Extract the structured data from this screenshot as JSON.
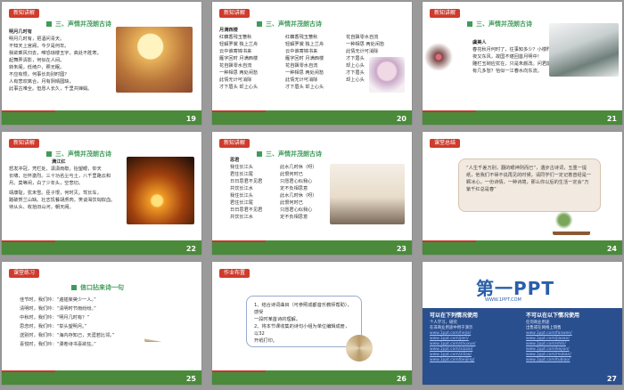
{
  "slides": [
    {
      "id": "s19",
      "number": "19",
      "tag": "新知讲解",
      "title": "三、声情并茂朗古诗",
      "heading": "明月几时有",
      "lines": [
        "明月几时有，把酒问青天。",
        "不知天上宫阙，今夕是何年。",
        "我欲乘风归去，唯恐琼楼玉宇，高处不胜寒。",
        "起舞弄清影，何似在人间。",
        "转朱阁，低绮户，照无眠。",
        "不应有恨，何事长向别时圆？",
        "人有悲欢离合，月有阴晴圆缺，",
        "此事古难全。但愿人长久，千里共婵娟。"
      ]
    },
    {
      "id": "s20",
      "number": "20",
      "tag": "新知讲解",
      "title": "三、声情并茂朗古诗",
      "heading": "月满西楼",
      "col1": [
        "红藕香残玉簟秋",
        "轻解罗裳 独上兰舟",
        "云中谁寄锦书来",
        "雁字回时 月满西楼",
        "花自飘零水自流",
        "一种相思 两处闲愁",
        "此情无计可消除",
        "才下眉头 却上心头"
      ],
      "col2": [
        "红藕香残玉簟秋",
        "轻解罗裳 独上兰舟",
        "云中谁寄锦书来",
        "雁字回时 月满西楼",
        "花自飘零水自流",
        "一种相思 两处闲愁",
        "此情无计可消除",
        "才下眉头 却上心头"
      ],
      "col3": [
        "花自飘零水自流",
        "一种相思 两处闲愁",
        "此情无计可消除",
        "才下眉头",
        "却上心头",
        "才下眉头",
        "却上心头"
      ]
    },
    {
      "id": "s21",
      "number": "21",
      "tag": "新知讲解",
      "title": "三、声情并茂朗古诗",
      "heading": "虞美人",
      "lines": [
        "春花秋月何时了，往事知多少？小楼昨",
        "夜又东风，故国不堪回首月明中！",
        "雕栏玉砌应犹在，只是朱颜改。问君能",
        "有几多愁？恰似一江春水向东流。"
      ]
    },
    {
      "id": "s22",
      "number": "22",
      "tag": "新知讲解",
      "title": "三、声情并茂朗古诗",
      "heading": "满江红",
      "lines": [
        "怒发冲冠，凭栏处、潇潇雨歇。抬望眼，仰天",
        "长啸，壮怀激烈。三十功名尘与土，八千里路云和",
        "月。莫等闲，白了少年头，空悲切。",
        "靖康耻，犹未雪。臣子恨，何时灭。驾长车，",
        "踏破贺兰山缺。壮志饥餐胡虏肉，笑谈渴饮匈奴血。",
        "待从头、收拾旧山河，朝天阙。"
      ]
    },
    {
      "id": "s23",
      "number": "23",
      "tag": "新知讲解",
      "title": "三、声情并茂朗古诗",
      "heading": "思君",
      "col1": [
        "我住长江头",
        "君住长江尾",
        "日日思君不见君",
        "共饮长江水",
        "我住长江头",
        "君住长江尾",
        "日日思君不见君",
        "共饮长江水"
      ],
      "col2": [
        "此水几时休（呀）",
        "此恨何时已",
        "只愿君心似我心",
        "定不负相思意",
        "此水几时休（呀）",
        "此恨何时已",
        "只愿君心似我心",
        "定不负相思意"
      ]
    },
    {
      "id": "s24",
      "number": "24",
      "tag": "课堂总结",
      "title": "",
      "quote": "“人生千差万别，翻的眼神则而已”，遇步古诗词，五重一提纸，他我们不得不说再见的时候，请同学们一定记着曾经是一颗冰心，一份诗情，一种诗境，那么你以后的生活一定会“万紫千红总是春”"
    },
    {
      "id": "s25",
      "number": "25",
      "tag": "课堂练习",
      "title": "信口拈来诗一句",
      "lines": [
        "佳节时，我们吟：“遍插茱萸少一人。”",
        "清明时，我们吟：“清明时节雨纷纷。”",
        "中秋时，我们吟：“明月几时有？”",
        "思念时，我们吟：“举头望明月。”",
        "送别时，我们吟：“海内存知己，天涯若比邻。”",
        "喜悦时，我们吟：“漫卷诗书喜欲狂。”"
      ]
    },
    {
      "id": "s26",
      "number": "26",
      "tag": "作业布置",
      "title": "",
      "lines": [
        "1、结合诗词曲目（可参照成都音乐教师帮助），感受",
        "一段时某首诗的理解。",
        "2、将本节课收集的诗句小组为单位编辑成册，以32",
        "开纸打印。"
      ]
    },
    {
      "id": "s27",
      "number": "27",
      "logo": "第一PPT",
      "url": "WWW.1PPT.COM",
      "left_header": "可以在下列情况使用",
      "right_header": "不可以在以下情况使用",
      "left_items": [
        "个人学习，研究",
        "在非商业用途中用于演示",
        "www.1ppt.com/hejia/",
        "www.1ppt.com/jieri/",
        "www.1ppt.com/shuxue/",
        "www.1ppt.com/xiazai/",
        "www.1ppt.com/ziliao/",
        "www.1ppt.com/beijing/"
      ],
      "right_items": [
        "任何商业用途",
        "出售或在网络上销售",
        "www.1ppt.com/fanwen/",
        "www.1ppt.com/jiaoan/",
        "www.1ppt.com/shiti/",
        "www.1ppt.com/kejian/",
        "www.1ppt.com/moban/",
        "www.1ppt.com/tubiao/"
      ]
    }
  ]
}
